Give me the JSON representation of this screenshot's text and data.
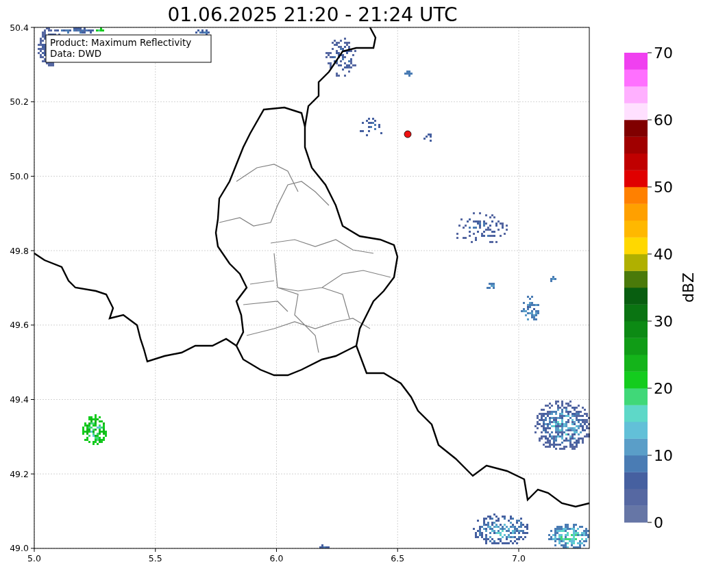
{
  "title": "01.06.2025 21:20 - 21:24 UTC",
  "map": {
    "info_box": [
      "Product: Maximum Reflectivity",
      "Data: DWD"
    ],
    "xticks": [
      "5.0",
      "5.5",
      "6.0",
      "6.5",
      "7.0"
    ],
    "yticks": [
      "50.4",
      "50.2",
      "50.0",
      "49.8",
      "49.6",
      "49.4",
      "49.2",
      "49.0"
    ]
  },
  "colorbar": {
    "label": "dBZ",
    "ticks": [
      "70",
      "60",
      "50",
      "40",
      "30",
      "20",
      "10",
      "0"
    ],
    "levels": [
      {
        "color": "#6676a6"
      },
      {
        "color": "#5668a2"
      },
      {
        "color": "#4660a0"
      },
      {
        "color": "#4a7cb4"
      },
      {
        "color": "#5a9ec8"
      },
      {
        "color": "#62c0d8"
      },
      {
        "color": "#5ed8c8"
      },
      {
        "color": "#40d878"
      },
      {
        "color": "#14cc1e"
      },
      {
        "color": "#14b41a"
      },
      {
        "color": "#109c16"
      },
      {
        "color": "#0c8a14"
      },
      {
        "color": "#0a7412"
      },
      {
        "color": "#085e10"
      },
      {
        "color": "#4a7a0a"
      },
      {
        "color": "#b0b000"
      },
      {
        "color": "#ffd800"
      },
      {
        "color": "#ffb800"
      },
      {
        "color": "#ffa000"
      },
      {
        "color": "#ff8000"
      },
      {
        "color": "#e00000"
      },
      {
        "color": "#c00000"
      },
      {
        "color": "#a00000"
      },
      {
        "color": "#800000"
      },
      {
        "color": "#ffe0ff"
      },
      {
        "color": "#ffb0ff"
      },
      {
        "color": "#ff70ff"
      },
      {
        "color": "#f040f0"
      }
    ]
  }
}
